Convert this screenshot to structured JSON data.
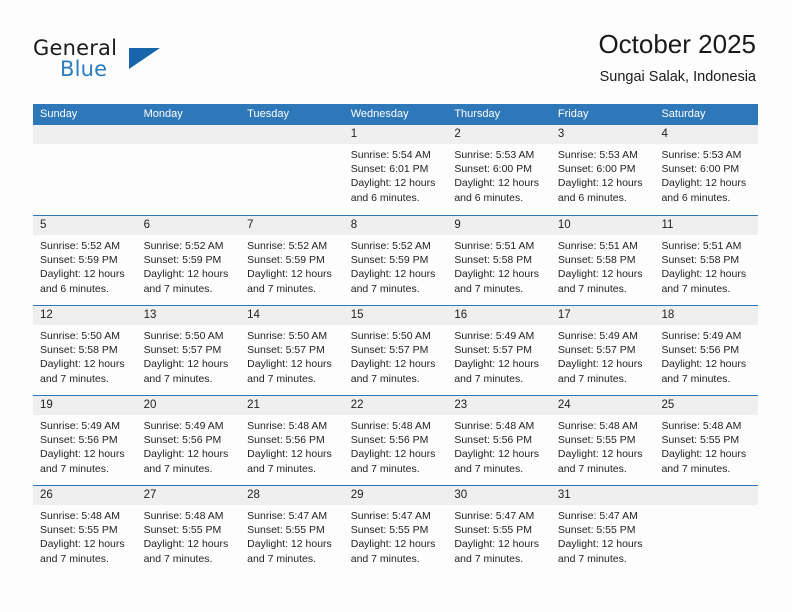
{
  "brand": {
    "word1": "General",
    "word2": "Blue",
    "triangle_color": "#1766ab",
    "blue_text_color": "#2b7cc0"
  },
  "header": {
    "title": "October 2025",
    "subtitle": "Sungai Salak, Indonesia"
  },
  "theme": {
    "header_blue": "#2e77b8",
    "row_separator": "#2e77b8",
    "date_strip_gray": "#efefef",
    "page_background": "#fdfdfd",
    "text_color": "#232323"
  },
  "weekday_headers": [
    "Sunday",
    "Monday",
    "Tuesday",
    "Wednesday",
    "Thursday",
    "Friday",
    "Saturday"
  ],
  "weeks": [
    [
      {
        "date": "",
        "empty": true,
        "sunrise": "",
        "sunset": "",
        "daylight_line1": "",
        "daylight_line2": ""
      },
      {
        "date": "",
        "empty": true,
        "sunrise": "",
        "sunset": "",
        "daylight_line1": "",
        "daylight_line2": ""
      },
      {
        "date": "",
        "empty": true,
        "sunrise": "",
        "sunset": "",
        "daylight_line1": "",
        "daylight_line2": ""
      },
      {
        "date": "1",
        "empty": false,
        "sunrise": "Sunrise: 5:54 AM",
        "sunset": "Sunset: 6:01 PM",
        "daylight_line1": "Daylight: 12 hours",
        "daylight_line2": "and 6 minutes."
      },
      {
        "date": "2",
        "empty": false,
        "sunrise": "Sunrise: 5:53 AM",
        "sunset": "Sunset: 6:00 PM",
        "daylight_line1": "Daylight: 12 hours",
        "daylight_line2": "and 6 minutes."
      },
      {
        "date": "3",
        "empty": false,
        "sunrise": "Sunrise: 5:53 AM",
        "sunset": "Sunset: 6:00 PM",
        "daylight_line1": "Daylight: 12 hours",
        "daylight_line2": "and 6 minutes."
      },
      {
        "date": "4",
        "empty": false,
        "sunrise": "Sunrise: 5:53 AM",
        "sunset": "Sunset: 6:00 PM",
        "daylight_line1": "Daylight: 12 hours",
        "daylight_line2": "and 6 minutes."
      }
    ],
    [
      {
        "date": "5",
        "empty": false,
        "sunrise": "Sunrise: 5:52 AM",
        "sunset": "Sunset: 5:59 PM",
        "daylight_line1": "Daylight: 12 hours",
        "daylight_line2": "and 6 minutes."
      },
      {
        "date": "6",
        "empty": false,
        "sunrise": "Sunrise: 5:52 AM",
        "sunset": "Sunset: 5:59 PM",
        "daylight_line1": "Daylight: 12 hours",
        "daylight_line2": "and 7 minutes."
      },
      {
        "date": "7",
        "empty": false,
        "sunrise": "Sunrise: 5:52 AM",
        "sunset": "Sunset: 5:59 PM",
        "daylight_line1": "Daylight: 12 hours",
        "daylight_line2": "and 7 minutes."
      },
      {
        "date": "8",
        "empty": false,
        "sunrise": "Sunrise: 5:52 AM",
        "sunset": "Sunset: 5:59 PM",
        "daylight_line1": "Daylight: 12 hours",
        "daylight_line2": "and 7 minutes."
      },
      {
        "date": "9",
        "empty": false,
        "sunrise": "Sunrise: 5:51 AM",
        "sunset": "Sunset: 5:58 PM",
        "daylight_line1": "Daylight: 12 hours",
        "daylight_line2": "and 7 minutes."
      },
      {
        "date": "10",
        "empty": false,
        "sunrise": "Sunrise: 5:51 AM",
        "sunset": "Sunset: 5:58 PM",
        "daylight_line1": "Daylight: 12 hours",
        "daylight_line2": "and 7 minutes."
      },
      {
        "date": "11",
        "empty": false,
        "sunrise": "Sunrise: 5:51 AM",
        "sunset": "Sunset: 5:58 PM",
        "daylight_line1": "Daylight: 12 hours",
        "daylight_line2": "and 7 minutes."
      }
    ],
    [
      {
        "date": "12",
        "empty": false,
        "sunrise": "Sunrise: 5:50 AM",
        "sunset": "Sunset: 5:58 PM",
        "daylight_line1": "Daylight: 12 hours",
        "daylight_line2": "and 7 minutes."
      },
      {
        "date": "13",
        "empty": false,
        "sunrise": "Sunrise: 5:50 AM",
        "sunset": "Sunset: 5:57 PM",
        "daylight_line1": "Daylight: 12 hours",
        "daylight_line2": "and 7 minutes."
      },
      {
        "date": "14",
        "empty": false,
        "sunrise": "Sunrise: 5:50 AM",
        "sunset": "Sunset: 5:57 PM",
        "daylight_line1": "Daylight: 12 hours",
        "daylight_line2": "and 7 minutes."
      },
      {
        "date": "15",
        "empty": false,
        "sunrise": "Sunrise: 5:50 AM",
        "sunset": "Sunset: 5:57 PM",
        "daylight_line1": "Daylight: 12 hours",
        "daylight_line2": "and 7 minutes."
      },
      {
        "date": "16",
        "empty": false,
        "sunrise": "Sunrise: 5:49 AM",
        "sunset": "Sunset: 5:57 PM",
        "daylight_line1": "Daylight: 12 hours",
        "daylight_line2": "and 7 minutes."
      },
      {
        "date": "17",
        "empty": false,
        "sunrise": "Sunrise: 5:49 AM",
        "sunset": "Sunset: 5:57 PM",
        "daylight_line1": "Daylight: 12 hours",
        "daylight_line2": "and 7 minutes."
      },
      {
        "date": "18",
        "empty": false,
        "sunrise": "Sunrise: 5:49 AM",
        "sunset": "Sunset: 5:56 PM",
        "daylight_line1": "Daylight: 12 hours",
        "daylight_line2": "and 7 minutes."
      }
    ],
    [
      {
        "date": "19",
        "empty": false,
        "sunrise": "Sunrise: 5:49 AM",
        "sunset": "Sunset: 5:56 PM",
        "daylight_line1": "Daylight: 12 hours",
        "daylight_line2": "and 7 minutes."
      },
      {
        "date": "20",
        "empty": false,
        "sunrise": "Sunrise: 5:49 AM",
        "sunset": "Sunset: 5:56 PM",
        "daylight_line1": "Daylight: 12 hours",
        "daylight_line2": "and 7 minutes."
      },
      {
        "date": "21",
        "empty": false,
        "sunrise": "Sunrise: 5:48 AM",
        "sunset": "Sunset: 5:56 PM",
        "daylight_line1": "Daylight: 12 hours",
        "daylight_line2": "and 7 minutes."
      },
      {
        "date": "22",
        "empty": false,
        "sunrise": "Sunrise: 5:48 AM",
        "sunset": "Sunset: 5:56 PM",
        "daylight_line1": "Daylight: 12 hours",
        "daylight_line2": "and 7 minutes."
      },
      {
        "date": "23",
        "empty": false,
        "sunrise": "Sunrise: 5:48 AM",
        "sunset": "Sunset: 5:56 PM",
        "daylight_line1": "Daylight: 12 hours",
        "daylight_line2": "and 7 minutes."
      },
      {
        "date": "24",
        "empty": false,
        "sunrise": "Sunrise: 5:48 AM",
        "sunset": "Sunset: 5:55 PM",
        "daylight_line1": "Daylight: 12 hours",
        "daylight_line2": "and 7 minutes."
      },
      {
        "date": "25",
        "empty": false,
        "sunrise": "Sunrise: 5:48 AM",
        "sunset": "Sunset: 5:55 PM",
        "daylight_line1": "Daylight: 12 hours",
        "daylight_line2": "and 7 minutes."
      }
    ],
    [
      {
        "date": "26",
        "empty": false,
        "sunrise": "Sunrise: 5:48 AM",
        "sunset": "Sunset: 5:55 PM",
        "daylight_line1": "Daylight: 12 hours",
        "daylight_line2": "and 7 minutes."
      },
      {
        "date": "27",
        "empty": false,
        "sunrise": "Sunrise: 5:48 AM",
        "sunset": "Sunset: 5:55 PM",
        "daylight_line1": "Daylight: 12 hours",
        "daylight_line2": "and 7 minutes."
      },
      {
        "date": "28",
        "empty": false,
        "sunrise": "Sunrise: 5:47 AM",
        "sunset": "Sunset: 5:55 PM",
        "daylight_line1": "Daylight: 12 hours",
        "daylight_line2": "and 7 minutes."
      },
      {
        "date": "29",
        "empty": false,
        "sunrise": "Sunrise: 5:47 AM",
        "sunset": "Sunset: 5:55 PM",
        "daylight_line1": "Daylight: 12 hours",
        "daylight_line2": "and 7 minutes."
      },
      {
        "date": "30",
        "empty": false,
        "sunrise": "Sunrise: 5:47 AM",
        "sunset": "Sunset: 5:55 PM",
        "daylight_line1": "Daylight: 12 hours",
        "daylight_line2": "and 7 minutes."
      },
      {
        "date": "31",
        "empty": false,
        "sunrise": "Sunrise: 5:47 AM",
        "sunset": "Sunset: 5:55 PM",
        "daylight_line1": "Daylight: 12 hours",
        "daylight_line2": "and 7 minutes."
      },
      {
        "date": "",
        "empty": true,
        "sunrise": "",
        "sunset": "",
        "daylight_line1": "",
        "daylight_line2": ""
      }
    ]
  ]
}
